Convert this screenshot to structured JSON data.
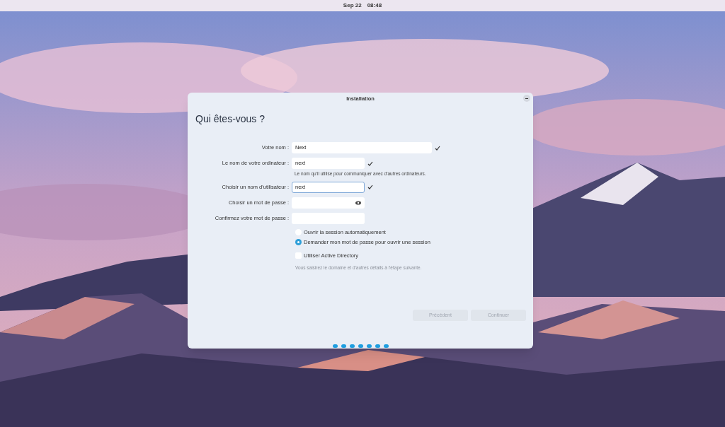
{
  "top_bar": {
    "date": "Sep 22",
    "time": "08:48"
  },
  "dialog": {
    "title": "Installation",
    "heading": "Qui êtes-vous ?",
    "fields": [
      {
        "label": "Votre nom :",
        "value": "Next",
        "kind": "text",
        "wide": true,
        "valid": true,
        "focused": false
      },
      {
        "label": "Le nom de votre ordinateur :",
        "value": "next",
        "kind": "text",
        "wide": false,
        "valid": true,
        "focused": false,
        "hint": "Le nom qu'il utilise pour communiquer avec d'autres ordinateurs."
      },
      {
        "label": "Choisir un nom d'utilisateur :",
        "value": "next",
        "kind": "text",
        "wide": false,
        "valid": true,
        "focused": true
      },
      {
        "label": "Choisir un mot de passe :",
        "kind": "password",
        "wide": false,
        "valid": false,
        "focused": false
      },
      {
        "label": "Confirmez votre mot de passe :",
        "kind": "text",
        "wide": false,
        "valid": false,
        "focused": false
      }
    ],
    "login_options": [
      {
        "label": "Ouvrir la session automatiquement",
        "selected": false
      },
      {
        "label": "Demander mon mot de passe pour ouvrir une session",
        "selected": true
      }
    ],
    "active_directory": {
      "label": "Utiliser Active Directory",
      "checked": false,
      "hint": "Vous saisirez le domaine et d'autres détails à l'étape suivante."
    },
    "buttons": [
      {
        "label": "Précédent",
        "disabled": true
      },
      {
        "label": "Continuer",
        "disabled": true
      }
    ],
    "step_dots": [
      {
        "selected": false
      },
      {
        "selected": false
      },
      {
        "selected": false
      },
      {
        "selected": false
      },
      {
        "selected": false
      },
      {
        "selected": false
      },
      {
        "selected": false
      }
    ]
  }
}
